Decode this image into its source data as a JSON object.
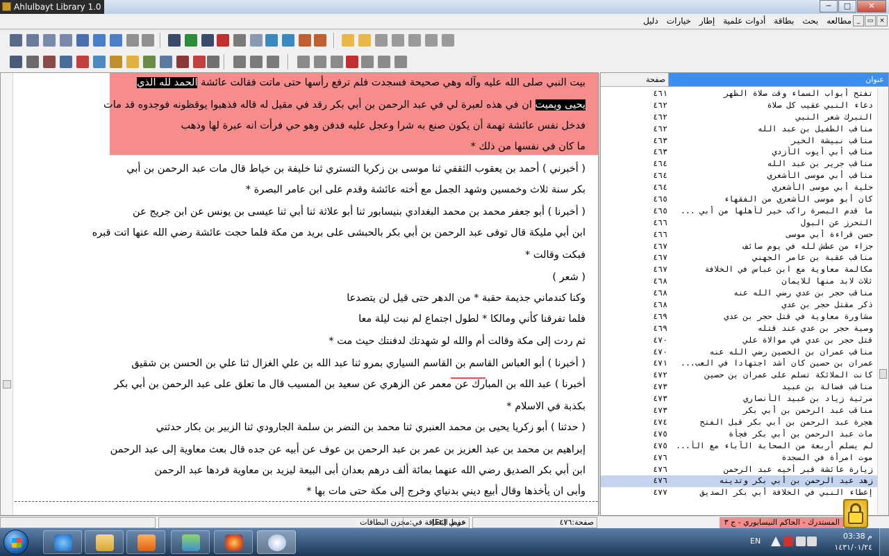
{
  "window": {
    "title": "Ahlulbayt Library 1.0",
    "buttons": {
      "minimize": "─",
      "maximize": "□",
      "close": "✕"
    }
  },
  "menu": {
    "items": [
      "مطالعه",
      "بحث",
      "بطاقة",
      "أدوات علمية",
      "إطار",
      "خيارات",
      "دليل"
    ],
    "mdi_buttons": [
      "×",
      "▭",
      "_"
    ]
  },
  "toolbar": {
    "row1_icons": [
      "book-open-icon",
      "tools-icon",
      "fit-width-icon",
      "fit-page-icon",
      "window-icon",
      "window-icon",
      "window-gray-icon",
      "binoculars-icon",
      "binoculars-icon",
      "checkbox-icon",
      "binoculars-icon",
      "find-question-icon",
      "find-star-icon",
      "eraser-icon",
      "swap-icon",
      "swap-icon",
      "tree-icon",
      "tree-icon",
      "folder-icon",
      "folder-open-icon",
      "copy-icon",
      "export-icon",
      "copy-icon",
      "notebook-icon"
    ],
    "row2_icons": [
      "allah-text-icon",
      "hook-icon",
      "document-icon",
      "grid-icon",
      "edit-icon",
      "sort-icon",
      "notes-icon",
      "add-icon",
      "page-down-icon",
      "pen-icon",
      "font-color-icon",
      "text-size-icon",
      "arrow-left-icon",
      "arrow-left-icon",
      "arrow-right-icon",
      "arrow-right-icon",
      "window-cascade-icon",
      "window-add-icon",
      "window-remove-icon",
      "close-window-icon",
      "window-gray-icon",
      "window-gray-icon",
      "window-gray-icon"
    ]
  },
  "reader": {
    "highlight_lines": [
      {
        "text": "بيت النبي صلى الله عليه وآله وهي صحيحة فسجدت فلم ترفع رأسها حتى ماتت فقالت عائشة ",
        "selected": "الحمد لله الذي"
      },
      {
        "text": "ان في هذه لعبرة لي في عبد الرحمن بن أبي بكر رقد في مقيل له قاله فذهبوا يوقظونه فوجدوه قد مات",
        "selected_start": "يحيى ويميت"
      },
      {
        "text": "فدخل نفس عائشة تهمة أن يكون صنع به شرا وعجل عليه فدفن وهو حي فرأت انه عبرة لها وذهب"
      },
      {
        "text": "ما كان في نفسها من ذلك *"
      }
    ],
    "lines": [
      "( أخبرني ) أحمد بن يعقوب الثقفي ثنا موسى بن زكريا التستري ثنا خليفة بن خياط قال مات عبد الرحمن بن أبي",
      "بكر سنة ثلاث وخمسين وشهد الجمل مع أخته عائشة وقدم على ابن عامر البصرة *",
      "( أخبرنا ) أبو جعفر محمد بن محمد البغدادي بنيسابور ثنا أبو علاثة ثنا أبي ثنا عيسى بن يونس عن ابن جريج عن",
      "ابن أبي مليكة قال توفى عبد الرحمن بن أبي بكر بالحبشى على بريد من مكة فلما حجت عائشة رضي الله عنها اتت قبره",
      "فبكت وقالت *",
      "( شعر )",
      "وكنا كندماني جذيمة حقبة * من الدهر حتى قيل لن يتصدعا",
      "فلما تفرقنا كأني ومالكا * لطول اجتماع لم نبت ليلة معا",
      "ثم ردت إلى مكة وقالت أم والله لو شهدتك لدفنتك حيث مت *",
      "( أخبرنا ) أبو العباس القاسم بن القاسم السياري بمرو ثنا عبد الله بن علي الغزال ثنا علي بن الحسن بن شقيق",
      "أخبرنا ) عبد الله بن المبارك عن معمر عن الزهري عن سعيد بن المسيب قال ما تعلق على عبد الرحمن بن أبي بكر",
      "بكذبة في الاسلام *",
      "( حدثنا ) أبو زكريا يحيى بن محمد العنبري ثنا محمد بن النضر بن سلمة الجارودي ثنا الزبير بن بكار حدثني",
      "إبراهيم بن محمد بن عبد العزيز بن عمر بن عبد الرحمن بن عوف عن أبيه عن جده قال بعث معاوية إلى عبد الرحمن",
      "ابن أبي بكر الصديق رضي الله عنهما بمائة ألف درهم بعدان أبى البيعة ليزيد بن معاوية فردها عبد الرحمن",
      "وأبى ان يأخذها وقال أبيع ديني بدنياي وخرج إلى مكة حتى مات بها *"
    ]
  },
  "index": {
    "header_title": "عنوان",
    "header_page": "صفحة",
    "rows": [
      {
        "title": "تفتح أبواب السماء وقت صلاة الظهر",
        "page": "٤٦١"
      },
      {
        "title": "دعاء النبي عقيب كل صلاة",
        "page": "٤٦٢"
      },
      {
        "title": "التبرك شعر النبي",
        "page": "٤٦٢"
      },
      {
        "title": "مناقب الطفيل بن عبد الله",
        "page": "٤٦٢"
      },
      {
        "title": "مناقب نبيشة الخير",
        "page": "٤٦٣"
      },
      {
        "title": "مناقب أبي أيوب الأزدي",
        "page": "٤٦٣"
      },
      {
        "title": "مناقب جرير بن عبد الله",
        "page": "٤٦٤"
      },
      {
        "title": "مناقب أبي موسى الأشعري",
        "page": "٤٦٤"
      },
      {
        "title": "حلية أبي موسى الأشعري",
        "page": "٤٦٤"
      },
      {
        "title": "كان أبو موسى الأشعري من الفقهاء",
        "page": "٤٦٥"
      },
      {
        "title": "ما قدم البصرة راكب خير لأهلها من أبي ...",
        "page": "٤٦٥"
      },
      {
        "title": "التحرز عن البول",
        "page": "٤٦٦"
      },
      {
        "title": "حسن قراءة أبي موسى",
        "page": "٤٦٦"
      },
      {
        "title": "جزاء من عطش لله في يوم صائف",
        "page": "٤٦٧"
      },
      {
        "title": "مناقب عقبة بن عامر الجهني",
        "page": "٤٦٧"
      },
      {
        "title": "مكالمة معاوية مع ابن عباس في الخلافة",
        "page": "٤٦٧"
      },
      {
        "title": "ثلاث لابد منها للايمان",
        "page": "٤٦٨"
      },
      {
        "title": "مناقب حجر بن عدي رضي الله عنه",
        "page": "٤٦٨"
      },
      {
        "title": "ذكر مقتل حجر بن عدي",
        "page": "٤٦٨"
      },
      {
        "title": "مشاورة معاوية في قتل حجر بن عدي",
        "page": "٤٦٩"
      },
      {
        "title": "وصية حجر بن عدي عند قتله",
        "page": "٤٦٩"
      },
      {
        "title": "قتل حجر بن عدي في موالاة علي",
        "page": "٤٧٠"
      },
      {
        "title": "مناقب عمران بن الحصين رضي الله عنه",
        "page": "٤٧٠"
      },
      {
        "title": "عمران بن حصين كان أشد اجتهادا في العب...",
        "page": "٤٧١"
      },
      {
        "title": "كانت الملائكة تسلم على عمران بن حصين",
        "page": "٤٧٢"
      },
      {
        "title": "مناقب فضالة بن عبيد",
        "page": "٤٧٣"
      },
      {
        "title": "مرثية زياد بن عبيد الأنصاري",
        "page": "٤٧٣"
      },
      {
        "title": "مناقب عبد الرحمن بن أبي بكر",
        "page": "٤٧٣"
      },
      {
        "title": "هجرة عبد الرحمن بن أبي بكر قبل الفتح",
        "page": "٤٧٤"
      },
      {
        "title": "مات عبد الرحمن بن أبي بكر فجأة",
        "page": "٤٧٥"
      },
      {
        "title": "لم يسلم أربعة من الصحابة الآباء مع الأ...",
        "page": "٤٧٥"
      },
      {
        "title": "موت امرأة في السجدة",
        "page": "٤٧٦"
      },
      {
        "title": "زيارة عائشة قبر أخيه عبد الرحمن",
        "page": "٤٧٦"
      },
      {
        "title": "زهد عبد الرحمن بن أبي بكر وتدينه",
        "page": "٤٧٦",
        "selected": true
      },
      {
        "title": "إعطاء النبي في الخلافة أبي بكر الصديق",
        "page": "٤٧٧"
      }
    ]
  },
  "status": {
    "page": "صفحة:٤٧٦",
    "lang": "عربي [F٢]",
    "saved": "حفظ البطاقة في:مخزن البطاقات",
    "book": "المستدرك - الحاكم النيسابوري - ج ٣"
  },
  "taskbar": {
    "lang": "EN",
    "time": "م 03:38",
    "date": "١٤٣١/٠١/٢٤"
  }
}
